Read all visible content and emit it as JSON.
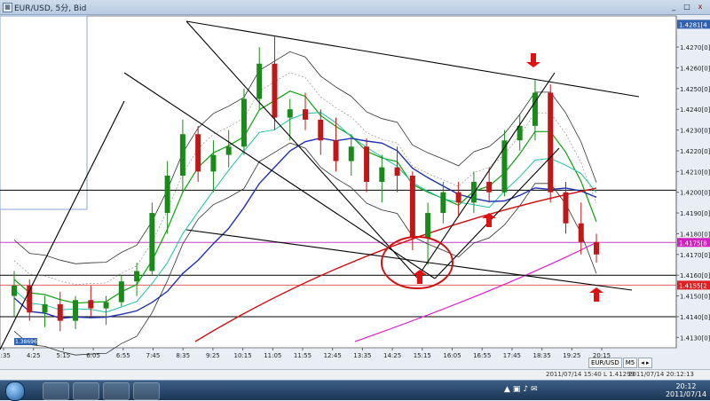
{
  "window": {
    "title": "EUR/USD, 5分, Bid",
    "min": "_",
    "max": "□",
    "close": "x"
  },
  "chart_data": {
    "type": "candlestick",
    "symbol": "EUR/USD",
    "ylim": [
      1.4125,
      1.4285
    ],
    "xlim": [
      "3:35",
      "20:15"
    ],
    "y_ticks": [
      "1.4270[0]",
      "1.4260[0]",
      "1.4250[0]",
      "1.4240[0]",
      "1.4230[0]",
      "1.4220[0]",
      "1.4210[0]",
      "1.4200[0]",
      "1.4190[0]",
      "1.4180[0]",
      "1.4170[0]",
      "1.4160[0]",
      "1.4150[0]",
      "1.4140[0]",
      "1.4130[0]"
    ],
    "y_tick_values": [
      1.427,
      1.426,
      1.425,
      1.424,
      1.423,
      1.422,
      1.421,
      1.42,
      1.419,
      1.418,
      1.417,
      1.416,
      1.415,
      1.414,
      1.413
    ],
    "x_ticks": [
      "3:35",
      "4:25",
      "5:15",
      "6:05",
      "6:55",
      "7:45",
      "8:35",
      "9:25",
      "10:15",
      "11:05",
      "11:55",
      "12:45",
      "13:35",
      "14:25",
      "15:15",
      "16:05",
      "16:55",
      "17:45",
      "18:35",
      "19:25",
      "20:15"
    ],
    "price_labels": [
      {
        "text": "1.4281[4",
        "value": 1.4281,
        "color": "#3060b0"
      },
      {
        "text": "1.4175[8",
        "value": 1.41758,
        "color": "#d020c0"
      },
      {
        "text": "1.4155[2",
        "value": 1.41552,
        "color": "#e02020"
      }
    ],
    "low_label": "1.38696",
    "horizontal_levels": [
      {
        "value": 1.4201,
        "color": "#000000"
      },
      {
        "value": 1.41758,
        "color": "#c040c0"
      },
      {
        "value": 1.416,
        "color": "#000000"
      },
      {
        "value": 1.41552,
        "color": "#e06060"
      },
      {
        "value": 1.414,
        "color": "#000000"
      }
    ],
    "ohlc": [
      {
        "x": 0,
        "o": 1.415,
        "h": 1.4162,
        "l": 1.414,
        "c": 1.4155
      },
      {
        "x": 1,
        "o": 1.4155,
        "h": 1.4158,
        "l": 1.4138,
        "c": 1.4142
      },
      {
        "x": 2,
        "o": 1.4142,
        "h": 1.415,
        "l": 1.4135,
        "c": 1.4146
      },
      {
        "x": 3,
        "o": 1.4146,
        "h": 1.4152,
        "l": 1.4133,
        "c": 1.4138
      },
      {
        "x": 4,
        "o": 1.4138,
        "h": 1.415,
        "l": 1.4134,
        "c": 1.4148
      },
      {
        "x": 5,
        "o": 1.4148,
        "h": 1.4155,
        "l": 1.414,
        "c": 1.4144
      },
      {
        "x": 6,
        "o": 1.4144,
        "h": 1.415,
        "l": 1.4136,
        "c": 1.4147
      },
      {
        "x": 7,
        "o": 1.4147,
        "h": 1.416,
        "l": 1.4145,
        "c": 1.4157
      },
      {
        "x": 8,
        "o": 1.4157,
        "h": 1.4166,
        "l": 1.415,
        "c": 1.4162
      },
      {
        "x": 9,
        "o": 1.4162,
        "h": 1.4195,
        "l": 1.416,
        "c": 1.419
      },
      {
        "x": 10,
        "o": 1.419,
        "h": 1.4215,
        "l": 1.418,
        "c": 1.4208
      },
      {
        "x": 11,
        "o": 1.4208,
        "h": 1.4235,
        "l": 1.42,
        "c": 1.4228
      },
      {
        "x": 12,
        "o": 1.4228,
        "h": 1.4232,
        "l": 1.4205,
        "c": 1.421
      },
      {
        "x": 13,
        "o": 1.421,
        "h": 1.4225,
        "l": 1.42,
        "c": 1.4218
      },
      {
        "x": 14,
        "o": 1.4218,
        "h": 1.423,
        "l": 1.4212,
        "c": 1.4222
      },
      {
        "x": 15,
        "o": 1.4222,
        "h": 1.425,
        "l": 1.4218,
        "c": 1.4245
      },
      {
        "x": 16,
        "o": 1.4245,
        "h": 1.427,
        "l": 1.424,
        "c": 1.4262
      },
      {
        "x": 17,
        "o": 1.4262,
        "h": 1.4275,
        "l": 1.423,
        "c": 1.4236
      },
      {
        "x": 18,
        "o": 1.4236,
        "h": 1.4245,
        "l": 1.4225,
        "c": 1.424
      },
      {
        "x": 19,
        "o": 1.424,
        "h": 1.4248,
        "l": 1.423,
        "c": 1.4235
      },
      {
        "x": 20,
        "o": 1.4235,
        "h": 1.424,
        "l": 1.4218,
        "c": 1.4225
      },
      {
        "x": 21,
        "o": 1.4225,
        "h": 1.4236,
        "l": 1.421,
        "c": 1.4215
      },
      {
        "x": 22,
        "o": 1.4215,
        "h": 1.4228,
        "l": 1.4208,
        "c": 1.4222
      },
      {
        "x": 23,
        "o": 1.4222,
        "h": 1.4226,
        "l": 1.42,
        "c": 1.4205
      },
      {
        "x": 24,
        "o": 1.4205,
        "h": 1.4218,
        "l": 1.4195,
        "c": 1.4212
      },
      {
        "x": 25,
        "o": 1.4212,
        "h": 1.4222,
        "l": 1.42,
        "c": 1.4208
      },
      {
        "x": 26,
        "o": 1.4208,
        "h": 1.421,
        "l": 1.4172,
        "c": 1.4178
      },
      {
        "x": 27,
        "o": 1.4178,
        "h": 1.4195,
        "l": 1.4165,
        "c": 1.419
      },
      {
        "x": 28,
        "o": 1.419,
        "h": 1.4205,
        "l": 1.4185,
        "c": 1.42
      },
      {
        "x": 29,
        "o": 1.42,
        "h": 1.4205,
        "l": 1.4188,
        "c": 1.4195
      },
      {
        "x": 30,
        "o": 1.4195,
        "h": 1.421,
        "l": 1.419,
        "c": 1.4205
      },
      {
        "x": 31,
        "o": 1.4205,
        "h": 1.4212,
        "l": 1.4195,
        "c": 1.42
      },
      {
        "x": 32,
        "o": 1.42,
        "h": 1.423,
        "l": 1.4198,
        "c": 1.4225
      },
      {
        "x": 33,
        "o": 1.4225,
        "h": 1.4238,
        "l": 1.422,
        "c": 1.4232
      },
      {
        "x": 34,
        "o": 1.4232,
        "h": 1.4254,
        "l": 1.4225,
        "c": 1.4248
      },
      {
        "x": 35,
        "o": 1.4248,
        "h": 1.4252,
        "l": 1.4195,
        "c": 1.42
      },
      {
        "x": 36,
        "o": 1.42,
        "h": 1.4205,
        "l": 1.418,
        "c": 1.4185
      },
      {
        "x": 37,
        "o": 1.4185,
        "h": 1.4195,
        "l": 1.417,
        "c": 1.4176
      },
      {
        "x": 38,
        "o": 1.4176,
        "h": 1.418,
        "l": 1.4166,
        "c": 1.417
      }
    ],
    "annotations": [
      "down-arrow at 18:35 top",
      "up-arrow at 15:15",
      "up-arrow at 16:55",
      "up-arrow at 20:15",
      "circle at 15:15 low"
    ]
  },
  "toolbar": {
    "symbol": "EUR/USD",
    "timeframe": "M5",
    "arrows": "◂ ▸"
  },
  "status": {
    "left": "2011/07/14 15:40 L 1.41299",
    "right": "2011/07/14 20:12:13"
  },
  "taskbar": {
    "time": "20:12",
    "date": "2011/07/14"
  },
  "colors": {
    "bg": "#ffffff",
    "bull": "#1a8a1a",
    "bear": "#c01818",
    "grid": "#000000"
  }
}
